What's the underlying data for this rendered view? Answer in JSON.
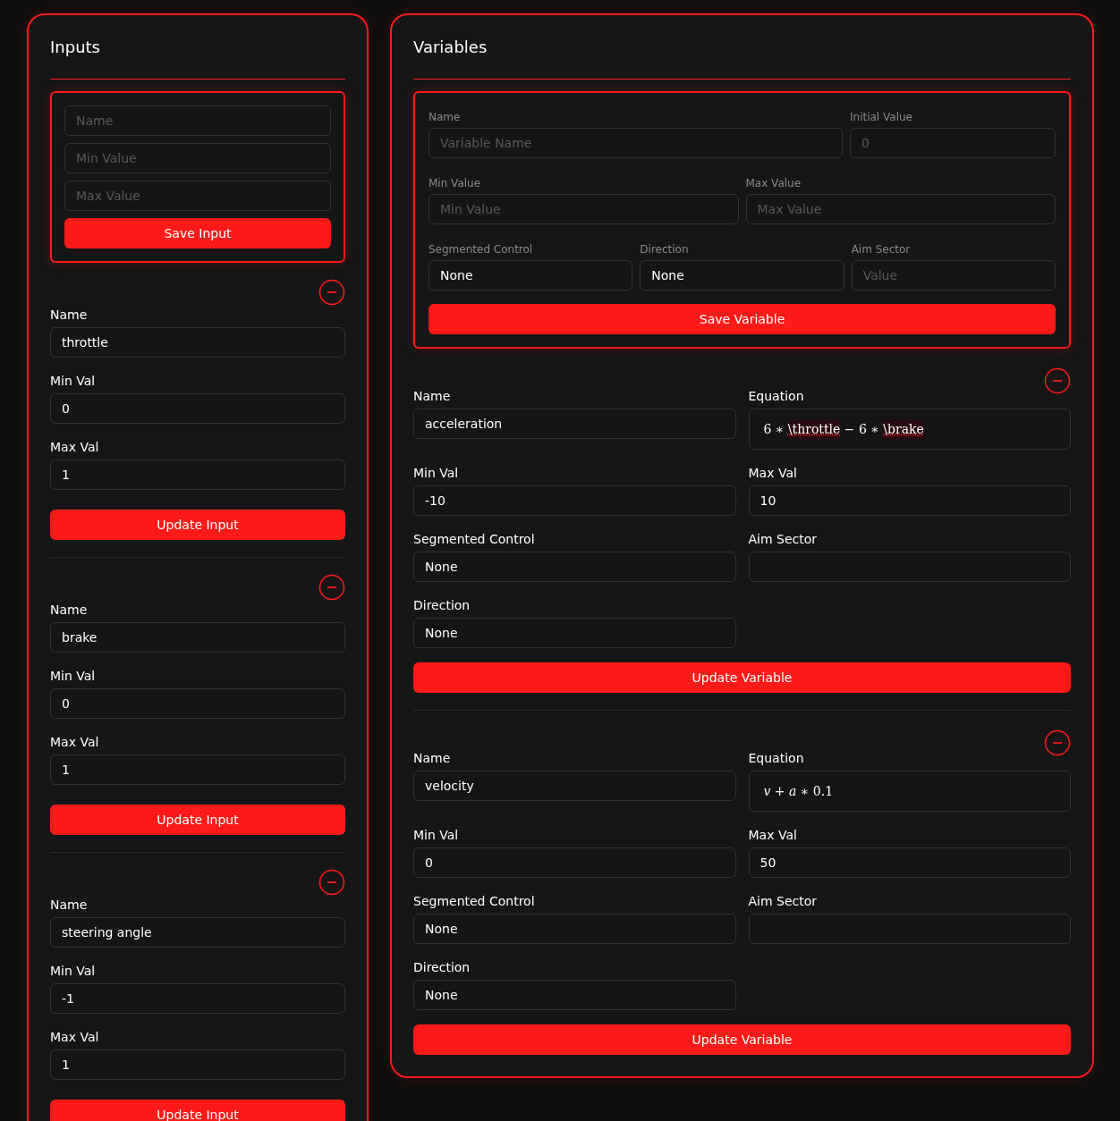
{
  "inputs_panel": {
    "title": "Inputs",
    "new_input_form": {
      "fields": [
        {
          "placeholder": "Name"
        },
        {
          "placeholder": "Min Value"
        },
        {
          "placeholder": "Max Value"
        }
      ],
      "button": "Save Input"
    },
    "items": [
      {
        "name_label": "Name",
        "name": "throttle",
        "min_label": "Min Val",
        "min": "0",
        "max_label": "Max Val",
        "max": "1",
        "button": "Update Input"
      },
      {
        "name_label": "Name",
        "name": "brake",
        "min_label": "Min Val",
        "min": "0",
        "max_label": "Max Val",
        "max": "1",
        "button": "Update Input"
      },
      {
        "name_label": "Name",
        "name": "steering angle",
        "min_label": "Min Val",
        "min": "-1",
        "max_label": "Max Val",
        "max": "1",
        "button": "Update Input"
      }
    ]
  },
  "variables_panel": {
    "title": "Variables",
    "new_variable_form": {
      "name": {
        "label": "Name",
        "placeholder": "Variable Name"
      },
      "initial": {
        "label": "Initial Value",
        "placeholder": "0"
      },
      "min": {
        "label": "Min Value",
        "placeholder": "Min Value"
      },
      "max": {
        "label": "Max Value",
        "placeholder": "Max Value"
      },
      "segmented": {
        "label": "Segmented Control",
        "value": "None"
      },
      "direction": {
        "label": "Direction",
        "value": "None"
      },
      "aim": {
        "label": "Aim Sector",
        "placeholder": "Value"
      },
      "button": "Save Variable"
    },
    "items": [
      {
        "name_label": "Name",
        "name": "acceleration",
        "equation_label": "Equation",
        "equation": [
          {
            "text": "6 ∗ ",
            "kind": "plain"
          },
          {
            "text": "\\throttle",
            "kind": "error"
          },
          {
            "text": " − 6 ∗ ",
            "kind": "plain"
          },
          {
            "text": "\\brake",
            "kind": "error"
          }
        ],
        "min_label": "Min Val",
        "min": "-10",
        "max_label": "Max Val",
        "max": "10",
        "segmented_label": "Segmented Control",
        "segmented": "None",
        "aim_label": "Aim Sector",
        "direction_label": "Direction",
        "direction": "None",
        "button": "Update Variable"
      },
      {
        "name_label": "Name",
        "name": "velocity",
        "equation_label": "Equation",
        "equation": [
          {
            "text": "v",
            "kind": "italic"
          },
          {
            "text": " + ",
            "kind": "plain"
          },
          {
            "text": "a",
            "kind": "italic"
          },
          {
            "text": " ∗ 0.1",
            "kind": "plain"
          }
        ],
        "min_label": "Min Val",
        "min": "0",
        "max_label": "Max Val",
        "max": "50",
        "segmented_label": "Segmented Control",
        "segmented": "None",
        "aim_label": "Aim Sector",
        "direction_label": "Direction",
        "direction": "None",
        "button": "Update Variable"
      }
    ]
  }
}
